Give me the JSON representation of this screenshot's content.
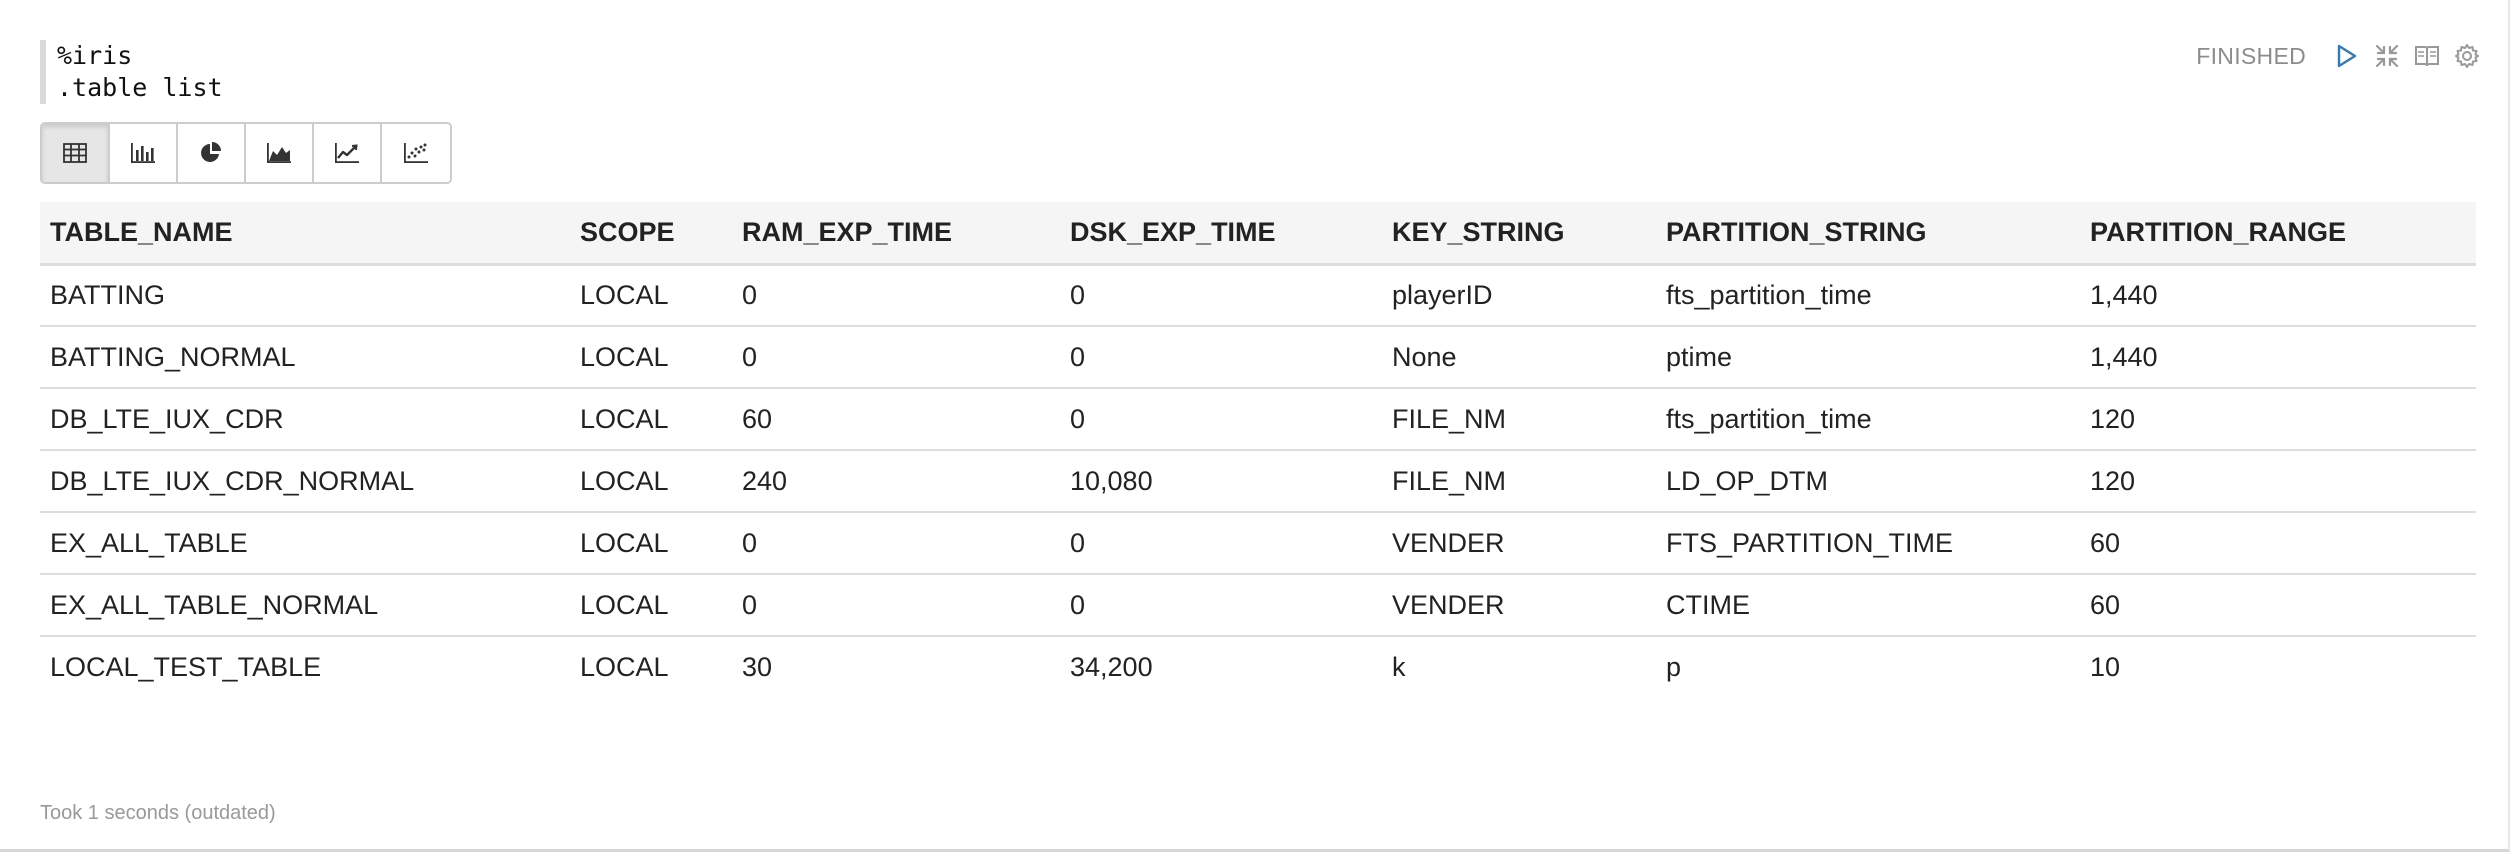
{
  "editor": {
    "lines": [
      "%iris",
      ".table list"
    ]
  },
  "controls": {
    "status": "FINISHED",
    "icons": [
      "run-icon",
      "collapse-icon",
      "book-icon",
      "gear-icon"
    ]
  },
  "toolbar": {
    "buttons": [
      {
        "icon": "table-icon",
        "active": true
      },
      {
        "icon": "bar-chart-icon",
        "active": false
      },
      {
        "icon": "pie-chart-icon",
        "active": false
      },
      {
        "icon": "area-chart-icon",
        "active": false
      },
      {
        "icon": "line-chart-icon",
        "active": false
      },
      {
        "icon": "scatter-chart-icon",
        "active": false
      }
    ]
  },
  "table": {
    "columns": [
      "TABLE_NAME",
      "SCOPE",
      "RAM_EXP_TIME",
      "DSK_EXP_TIME",
      "KEY_STRING",
      "PARTITION_STRING",
      "PARTITION_RANGE"
    ],
    "rows": [
      [
        "BATTING",
        "LOCAL",
        "0",
        "0",
        "playerID",
        "fts_partition_time",
        "1,440"
      ],
      [
        "BATTING_NORMAL",
        "LOCAL",
        "0",
        "0",
        "None",
        "ptime",
        "1,440"
      ],
      [
        "DB_LTE_IUX_CDR",
        "LOCAL",
        "60",
        "0",
        "FILE_NM",
        "fts_partition_time",
        "120"
      ],
      [
        "DB_LTE_IUX_CDR_NORMAL",
        "LOCAL",
        "240",
        "10,080",
        "FILE_NM",
        "LD_OP_DTM",
        "120"
      ],
      [
        "EX_ALL_TABLE",
        "LOCAL",
        "0",
        "0",
        "VENDER",
        "FTS_PARTITION_TIME",
        "60"
      ],
      [
        "EX_ALL_TABLE_NORMAL",
        "LOCAL",
        "0",
        "0",
        "VENDER",
        "CTIME",
        "60"
      ],
      [
        "LOCAL_TEST_TABLE",
        "LOCAL",
        "30",
        "34,200",
        "k",
        "p",
        "10"
      ]
    ]
  },
  "footer": {
    "text": "Took 1 seconds (outdated)"
  },
  "colors": {
    "accent": "#337ab7",
    "icon_gray": "#999999",
    "header_bg": "#f5f5f5",
    "border": "#dddddd"
  }
}
